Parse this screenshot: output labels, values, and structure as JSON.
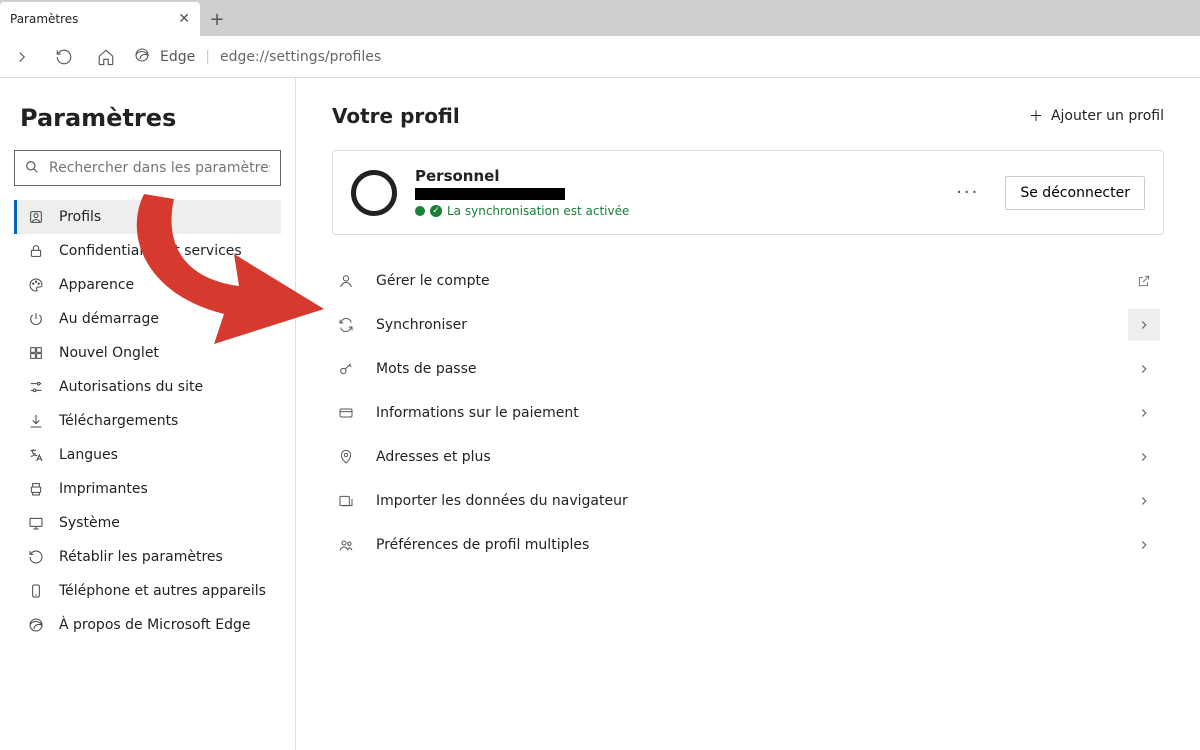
{
  "tab": {
    "title": "Paramètres"
  },
  "addressbar": {
    "label": "Edge",
    "url": "edge://settings/profiles"
  },
  "sidebar": {
    "title": "Paramètres",
    "search_placeholder": "Rechercher dans les paramètres",
    "items": [
      {
        "label": "Profils"
      },
      {
        "label": "Confidentialité et services"
      },
      {
        "label": "Apparence"
      },
      {
        "label": "Au démarrage"
      },
      {
        "label": "Nouvel Onglet"
      },
      {
        "label": "Autorisations du site"
      },
      {
        "label": "Téléchargements"
      },
      {
        "label": "Langues"
      },
      {
        "label": "Imprimantes"
      },
      {
        "label": "Système"
      },
      {
        "label": "Rétablir les paramètres"
      },
      {
        "label": "Téléphone et autres appareils"
      },
      {
        "label": "À propos de Microsoft Edge"
      }
    ]
  },
  "main": {
    "heading": "Votre profil",
    "add_profile": "Ajouter un profil",
    "profile": {
      "name": "Personnel",
      "sync_status": "La synchronisation est activée",
      "signout": "Se déconnecter"
    },
    "rows": [
      {
        "label": "Gérer le compte"
      },
      {
        "label": "Synchroniser"
      },
      {
        "label": "Mots de passe"
      },
      {
        "label": "Informations sur le paiement"
      },
      {
        "label": "Adresses et plus"
      },
      {
        "label": "Importer les données du navigateur"
      },
      {
        "label": "Préférences de profil multiples"
      }
    ]
  }
}
